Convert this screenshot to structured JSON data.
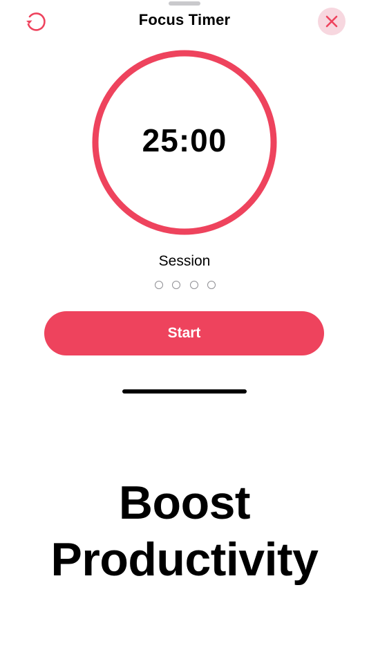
{
  "header": {
    "title": "Focus Timer",
    "reset_icon": "reset-icon",
    "close_icon": "close-icon"
  },
  "timer": {
    "time": "25:00",
    "progress": 1.0
  },
  "session": {
    "label": "Session",
    "total": 4,
    "completed": 0
  },
  "actions": {
    "start_label": "Start"
  },
  "promo": {
    "line1": "Boost",
    "line2": "Productivity"
  },
  "colors": {
    "accent": "#ee435d",
    "close_bg": "#f7d7df"
  }
}
